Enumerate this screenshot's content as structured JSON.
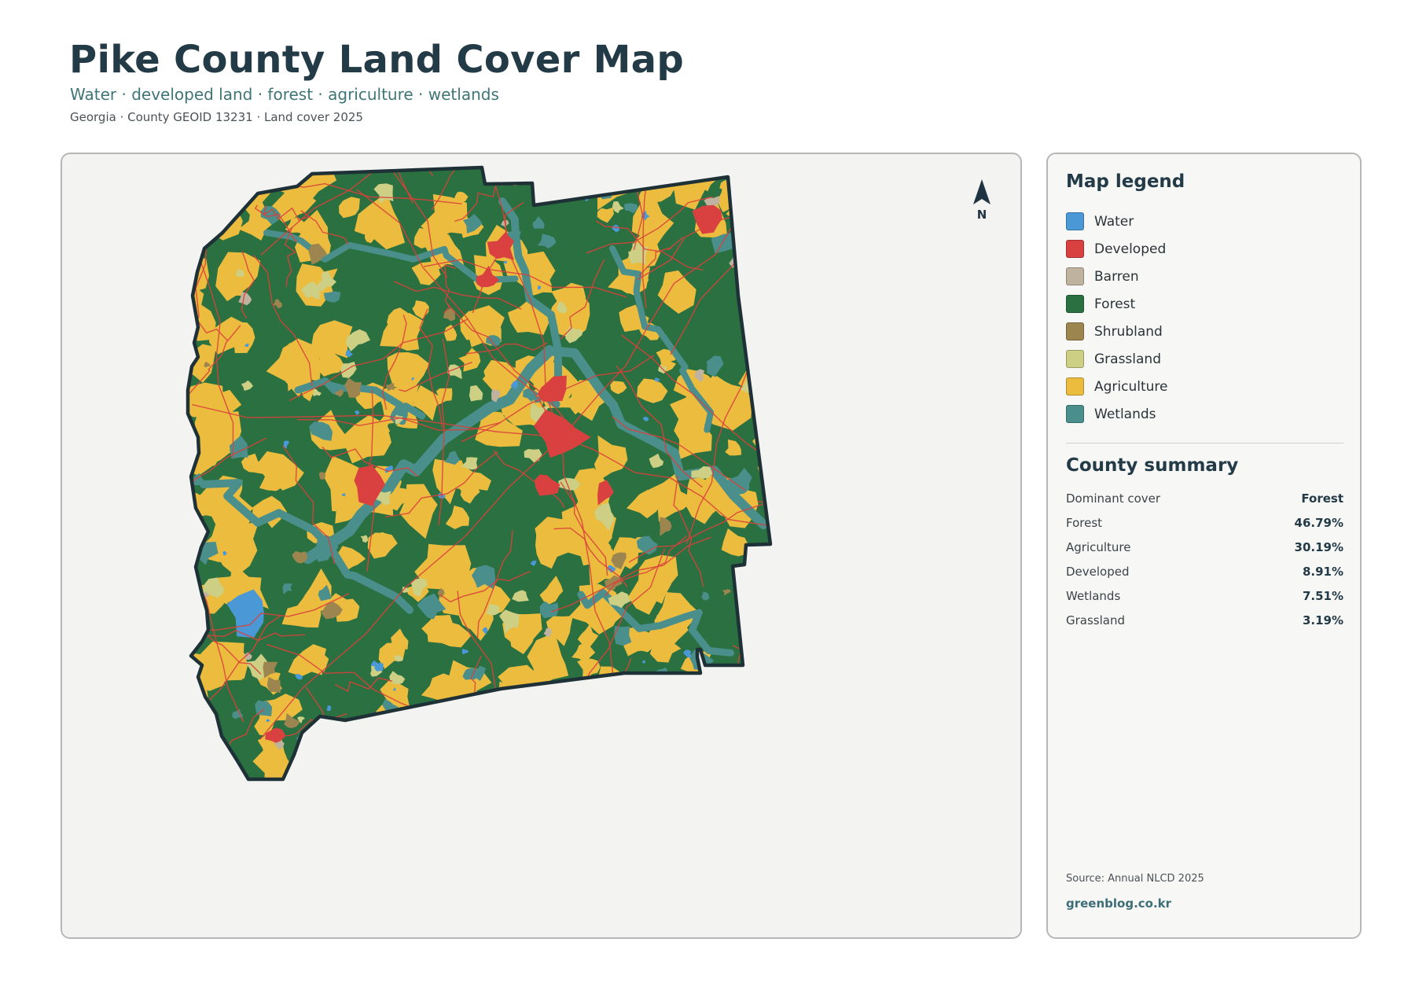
{
  "header": {
    "title": "Pike County Land Cover Map",
    "subtitle": "Water · developed land · forest · agriculture · wetlands",
    "meta": "Georgia · County GEOID 13231 · Land cover 2025"
  },
  "map": {
    "north_label": "N",
    "colors": {
      "water": "#4a98d6",
      "developed": "#d94141",
      "barren": "#bfb3a0",
      "forest": "#2a7040",
      "shrubland": "#9c854f",
      "grassland": "#cccf84",
      "agriculture": "#ecbc3f",
      "wetlands": "#4a8f8c",
      "boundary": "#1e3136",
      "roads": "#d9413b"
    }
  },
  "legend": {
    "heading": "Map legend",
    "items": [
      {
        "label": "Water",
        "color": "#4a98d6"
      },
      {
        "label": "Developed",
        "color": "#d94141"
      },
      {
        "label": "Barren",
        "color": "#bfb3a0"
      },
      {
        "label": "Forest",
        "color": "#2a7040"
      },
      {
        "label": "Shrubland",
        "color": "#9c854f"
      },
      {
        "label": "Grassland",
        "color": "#cccf84"
      },
      {
        "label": "Agriculture",
        "color": "#ecbc3f"
      },
      {
        "label": "Wetlands",
        "color": "#4a8f8c"
      }
    ]
  },
  "summary": {
    "heading": "County summary",
    "rows": [
      {
        "label": "Dominant cover",
        "value": "Forest"
      },
      {
        "label": "Forest",
        "value": "46.79%"
      },
      {
        "label": "Agriculture",
        "value": "30.19%"
      },
      {
        "label": "Developed",
        "value": "8.91%"
      },
      {
        "label": "Wetlands",
        "value": "7.51%"
      },
      {
        "label": "Grassland",
        "value": "3.19%"
      }
    ]
  },
  "footer": {
    "source": "Source: Annual NLCD 2025",
    "site": "greenblog.co.kr"
  }
}
